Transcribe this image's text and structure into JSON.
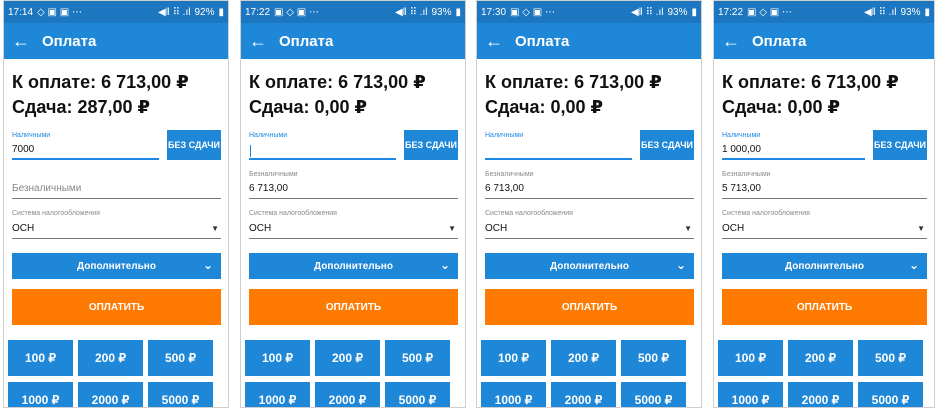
{
  "screens": [
    {
      "status": {
        "time": "17:14",
        "notif_icons": "◇ ▣ ▣ ⋯",
        "signal": "◀‖ ⠿ .ıl",
        "battery": "92%"
      },
      "title": "Оплата",
      "due": "К оплате: 6 713,00 ₽",
      "change": "Сдача: 287,00 ₽",
      "cash": {
        "label": "Наличными",
        "value": "7000",
        "placeholder": ""
      },
      "no_change_label": "БЕЗ СДАЧИ",
      "noncash": {
        "label": "",
        "value": "",
        "placeholder": "Безналичными"
      },
      "tax": {
        "label": "Система налогообложения",
        "value": "ОСН"
      },
      "more_label": "Дополнительно",
      "pay_label": "ОПЛАТИТЬ",
      "quick": [
        "100 ₽",
        "200 ₽",
        "500 ₽",
        "1000 ₽",
        "2000 ₽",
        "5000 ₽"
      ]
    },
    {
      "status": {
        "time": "17:22",
        "notif_icons": "▣ ◇ ▣ ⋯",
        "signal": "◀‖ ⠿ .ıl",
        "battery": "93%"
      },
      "title": "Оплата",
      "due": "К оплате: 6 713,00 ₽",
      "change": "Сдача: 0,00 ₽",
      "cash": {
        "label": "Наличными",
        "value": "",
        "placeholder": ""
      },
      "no_change_label": "БЕЗ СДАЧИ",
      "noncash": {
        "label": "Безналичными",
        "value": "6 713,00",
        "placeholder": ""
      },
      "tax": {
        "label": "Система налогообложения",
        "value": "ОСН"
      },
      "more_label": "Дополнительно",
      "pay_label": "ОПЛАТИТЬ",
      "quick": [
        "100 ₽",
        "200 ₽",
        "500 ₽",
        "1000 ₽",
        "2000 ₽",
        "5000 ₽"
      ]
    },
    {
      "status": {
        "time": "17:30",
        "notif_icons": "▣ ◇ ▣ ⋯",
        "signal": "◀‖ ⠿ .ıl",
        "battery": "93%"
      },
      "title": "Оплата",
      "due": "К оплате: 6 713,00 ₽",
      "change": "Сдача: 0,00 ₽",
      "cash": {
        "label": "Наличными",
        "value": "",
        "placeholder": ""
      },
      "no_change_label": "БЕЗ СДАЧИ",
      "noncash": {
        "label": "Безналичными",
        "value": "6 713,00",
        "placeholder": ""
      },
      "tax": {
        "label": "Система налогообложения",
        "value": "ОСН"
      },
      "more_label": "Дополнительно",
      "pay_label": "ОПЛАТИТЬ",
      "quick": [
        "100 ₽",
        "200 ₽",
        "500 ₽",
        "1000 ₽",
        "2000 ₽",
        "5000 ₽"
      ]
    },
    {
      "status": {
        "time": "17:22",
        "notif_icons": "▣ ◇ ▣ ⋯",
        "signal": "◀‖ ⠿ .ıl",
        "battery": "93%"
      },
      "title": "Оплата",
      "due": "К оплате: 6 713,00 ₽",
      "change": "Сдача: 0,00 ₽",
      "cash": {
        "label": "Наличными",
        "value": "1 000,00",
        "placeholder": ""
      },
      "no_change_label": "БЕЗ СДАЧИ",
      "noncash": {
        "label": "Безналичными",
        "value": "5 713,00",
        "placeholder": ""
      },
      "tax": {
        "label": "Система налогообложения",
        "value": "ОСН"
      },
      "more_label": "Дополнительно",
      "pay_label": "ОПЛАТИТЬ",
      "quick": [
        "100 ₽",
        "200 ₽",
        "500 ₽",
        "1000 ₽",
        "2000 ₽",
        "5000 ₽"
      ]
    }
  ],
  "colors": {
    "app_blue": "#1f87d8",
    "status_blue": "#1d77c0",
    "pay_orange": "#ff7a00",
    "field_blue": "#1e88e5"
  }
}
